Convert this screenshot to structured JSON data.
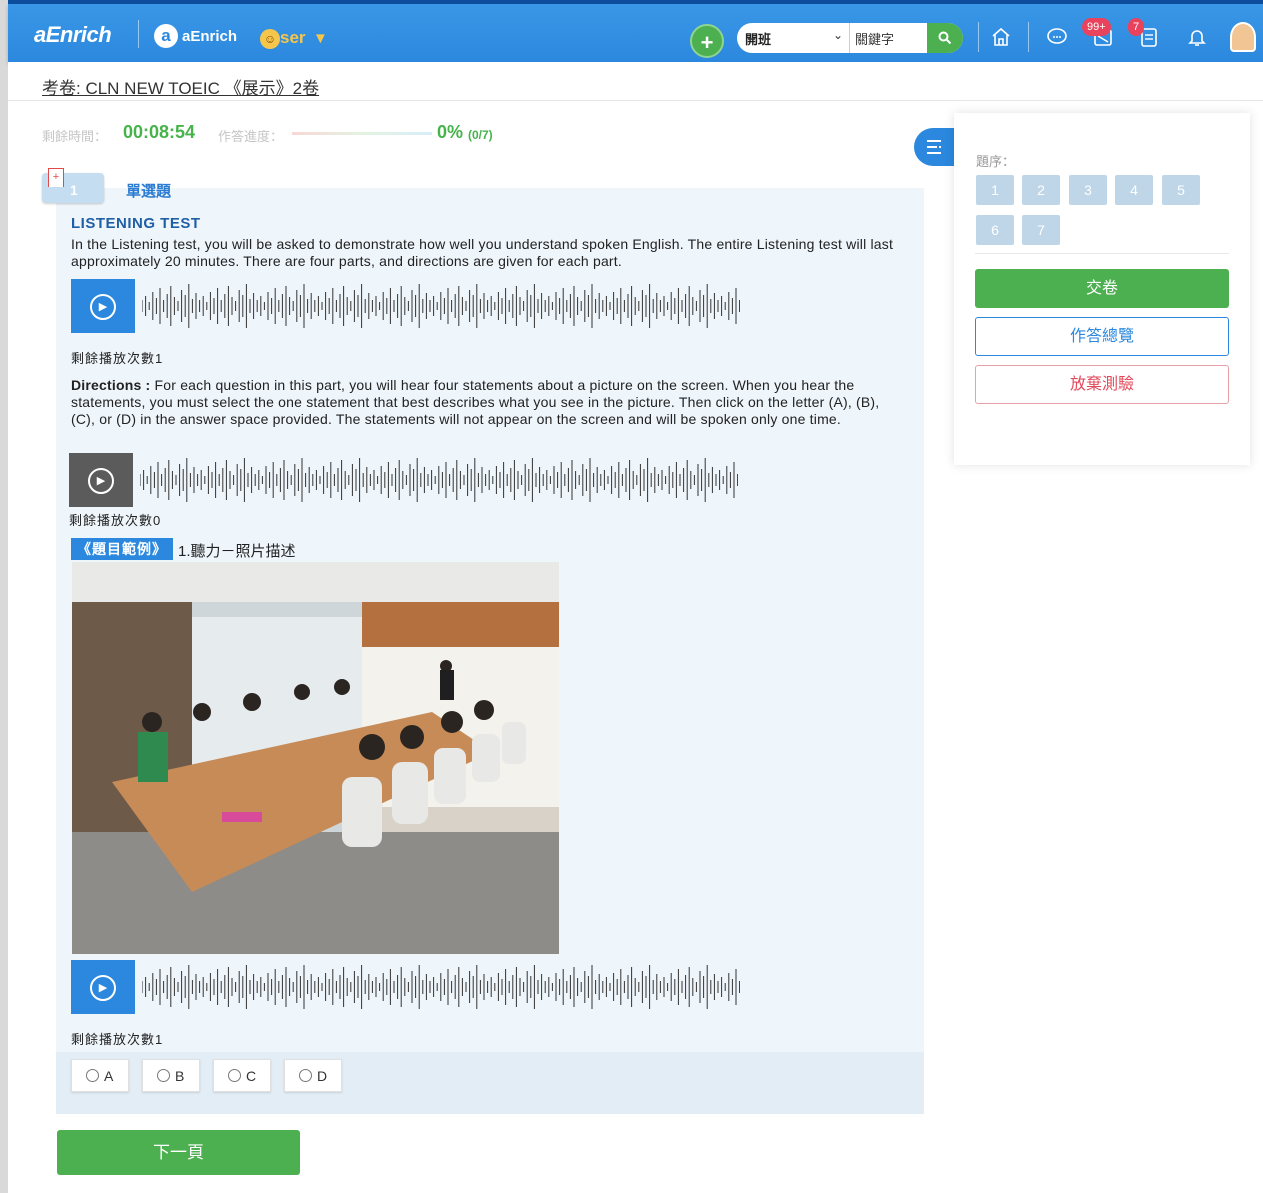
{
  "header": {
    "logo": "aEnrich",
    "brand_name": "aEnrich",
    "user_label": "ser",
    "add_label": "+",
    "search_type": "開班",
    "search_placeholder": "關鍵字",
    "messages_badge": "99+",
    "tasks_badge": "7"
  },
  "exam": {
    "title": "考卷: CLN NEW TOEIC 《展示》2卷",
    "remaining_time_label": "剩餘時間：",
    "remaining_time": "00:08:54",
    "progress_label": "作答進度：",
    "progress_percent": "0%",
    "progress_count": "(0/7)",
    "progress_value": 0
  },
  "question": {
    "number": "1",
    "type": "單選題",
    "section_title": "LISTENING TEST",
    "intro": "In the Listening test, you will be asked to demonstrate how well you understand spoken English. The entire Listening test will last approximately 20 minutes. There are four parts, and directions are given for each part.",
    "audio1_remaining": "剩餘播放次數1",
    "directions_label": "Directions :",
    "directions_text": " For each question in this part, you will hear four statements about a picture on the screen. When you hear the statements, you must select the one statement that best describes what you see in the picture. Then click on the letter (A), (B), (C), or (D) in the answer space provided. The statements will not appear on the screen and will be spoken only one time.",
    "audio2_remaining": "剩餘播放次數0",
    "example_tag": "《題目範例》",
    "example_text": "1.聽力－照片描述",
    "audio3_remaining": "剩餘播放次數1",
    "options": [
      "A",
      "B",
      "C",
      "D"
    ],
    "next_label": "下一頁"
  },
  "sidebar": {
    "order_label": "題序：",
    "question_numbers": [
      "1",
      "2",
      "3",
      "4",
      "5",
      "6",
      "7"
    ],
    "submit_label": "交卷",
    "overview_label": "作答總覽",
    "abandon_label": "放棄測驗"
  },
  "colors": {
    "header_blue": "#2b88de",
    "green": "#4caf50",
    "danger": "#e24a5c"
  }
}
